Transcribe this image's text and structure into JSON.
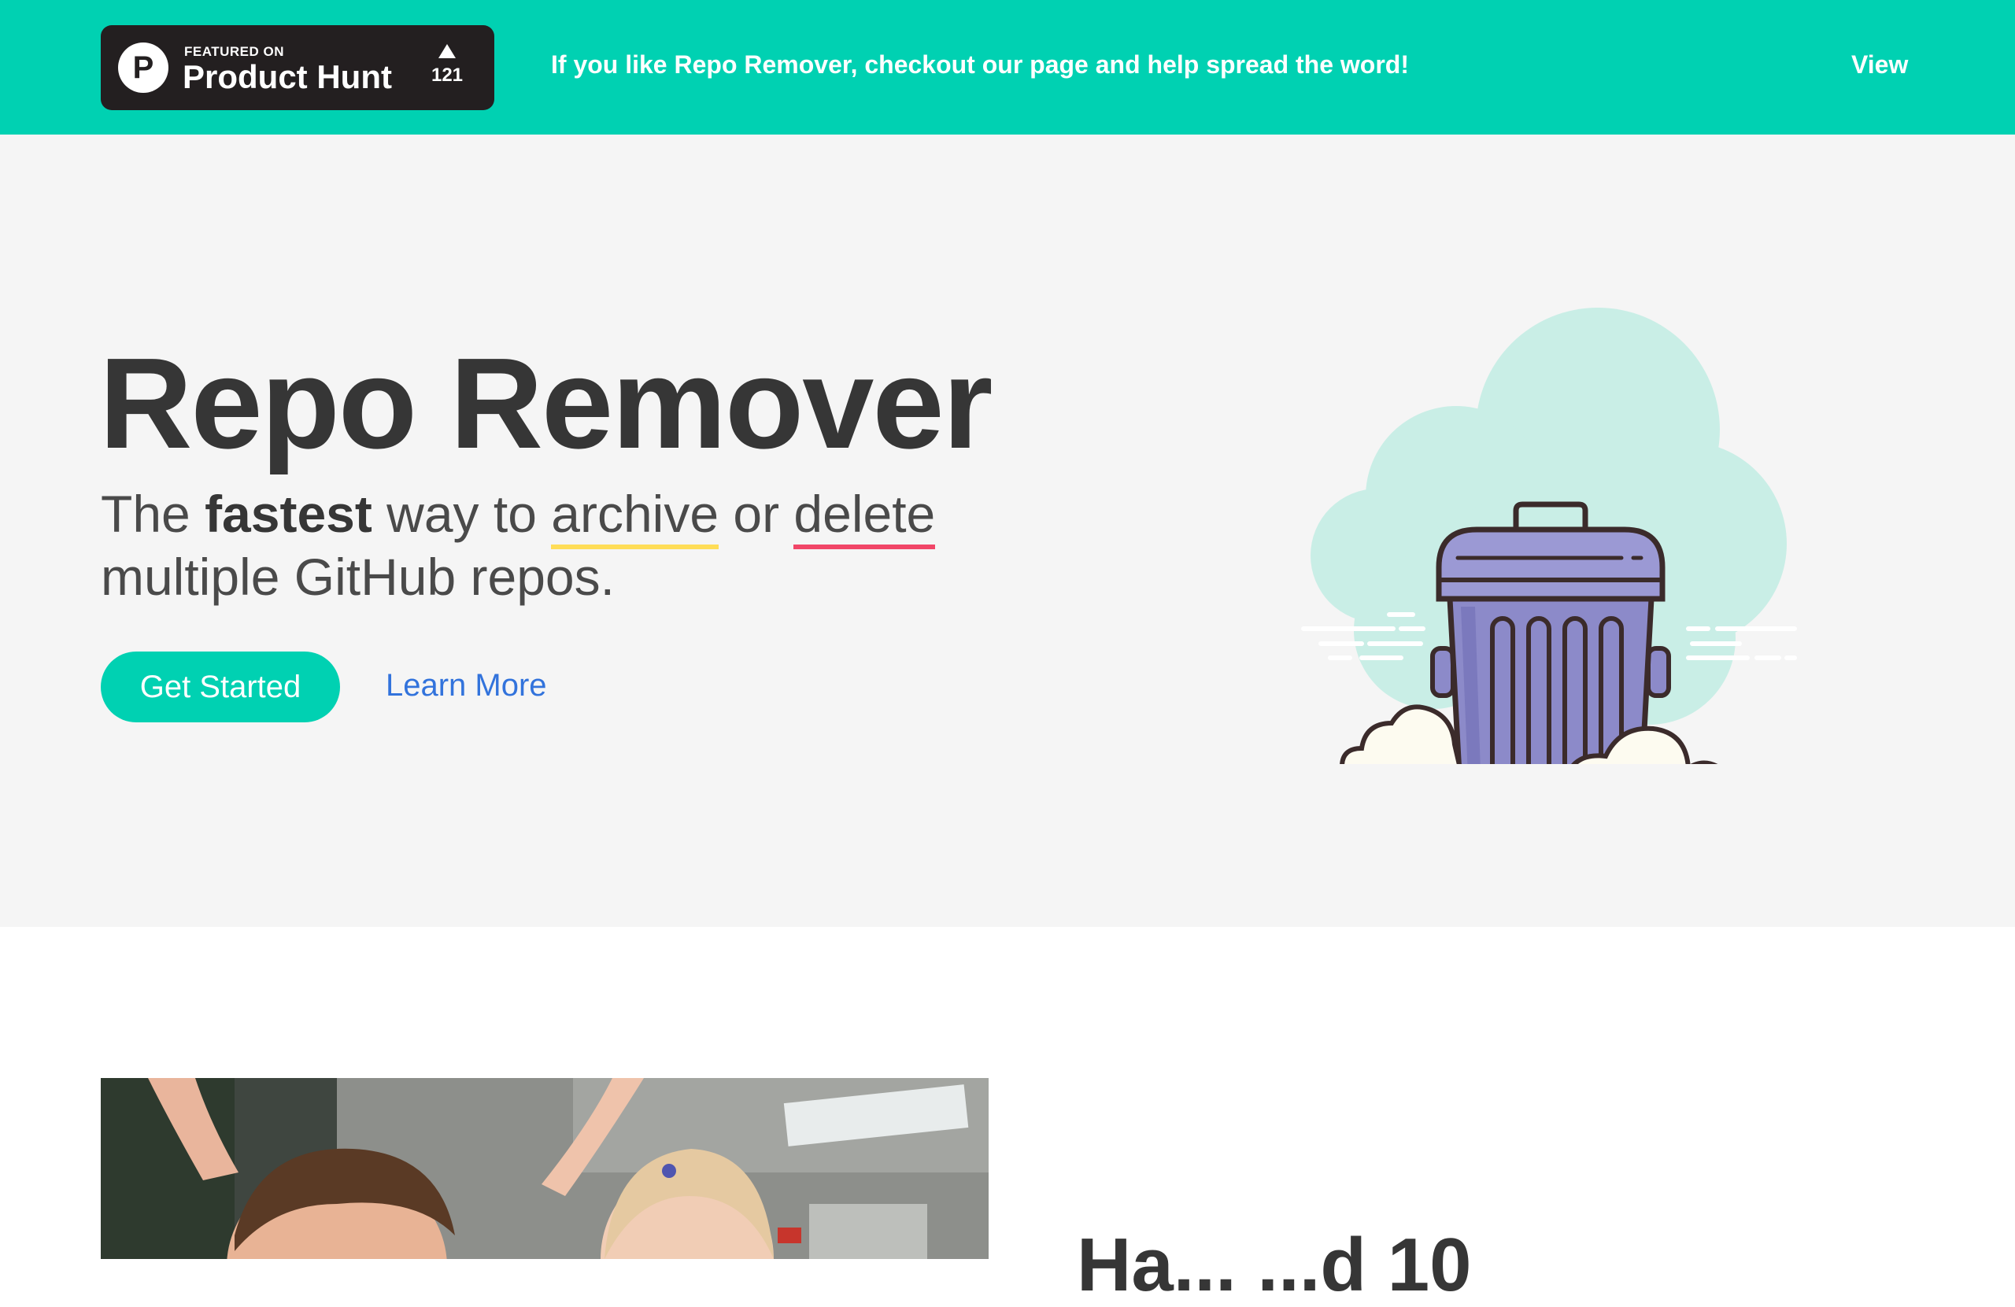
{
  "banner": {
    "badge": {
      "logo_letter": "P",
      "featured_label": "FEATURED ON",
      "brand": "Product Hunt",
      "upvote_count": "121"
    },
    "message": "If you like Repo Remover, checkout our page and help spread the word!",
    "view_label": "View"
  },
  "hero": {
    "title": "Repo Remover",
    "subtitle": {
      "part1": "The ",
      "fastest": "fastest",
      "part2": " way to ",
      "archive": "archive",
      "part3": " or ",
      "delete": "delete",
      "part4": " multiple GitHub repos."
    },
    "get_started_label": "Get Started",
    "learn_more_label": "Learn More",
    "illustration_icon": "trash-can-in-clouds-icon"
  },
  "section": {
    "heading": "Ha...   ...d 10"
  },
  "colors": {
    "primary": "#00d1b2",
    "link": "#3273dc",
    "hero_bg": "#f5f5f5",
    "badge_bg": "#231f20",
    "archive_underline": "#ffdd57",
    "delete_underline": "#f14668",
    "trash_purple": "#8c8ac9"
  }
}
